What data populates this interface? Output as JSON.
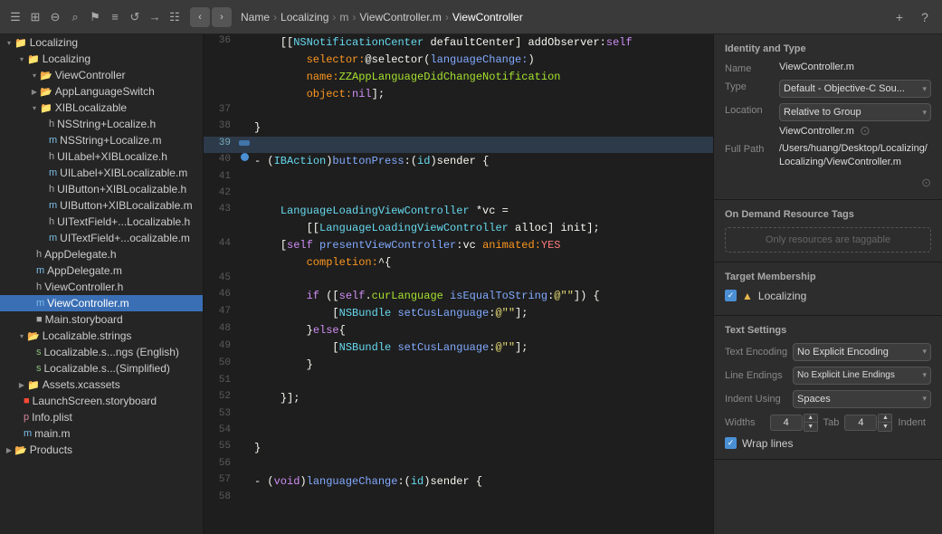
{
  "topbar": {
    "nav_back": "‹",
    "nav_forward": "›",
    "breadcrumbs": [
      "Localizing",
      "Localizing",
      "m",
      "ViewController.m",
      "ViewController"
    ],
    "action_plus": "+",
    "action_help": "?"
  },
  "sidebar": {
    "items": [
      {
        "id": "localizing-root",
        "label": "Localizing",
        "indent": 0,
        "type": "folder-yellow",
        "arrow": "▾",
        "selected": false
      },
      {
        "id": "localizing-sub",
        "label": "Localizing",
        "indent": 1,
        "type": "folder-yellow",
        "arrow": "▾",
        "selected": false
      },
      {
        "id": "viewcontroller",
        "label": "ViewController",
        "indent": 2,
        "type": "folder-blue",
        "arrow": "▾",
        "selected": false
      },
      {
        "id": "applanguageswitch",
        "label": "AppLanguageSwitch",
        "indent": 2,
        "type": "folder-blue",
        "arrow": "▶",
        "selected": false
      },
      {
        "id": "xiblocalizable",
        "label": "XIBLocalizable",
        "indent": 2,
        "type": "folder-yellow",
        "arrow": "▾",
        "selected": false
      },
      {
        "id": "nsstring-h",
        "label": "NSString+Localize.h",
        "indent": 3,
        "type": "file-h",
        "arrow": "",
        "selected": false
      },
      {
        "id": "nsstring-m",
        "label": "NSString+Localize.m",
        "indent": 3,
        "type": "file-m",
        "arrow": "",
        "selected": false
      },
      {
        "id": "uilabel-h",
        "label": "UILabel+XIBLocalize.h",
        "indent": 3,
        "type": "file-h",
        "arrow": "",
        "selected": false
      },
      {
        "id": "uilabel-m",
        "label": "UILabel+XIBLocalizable.m",
        "indent": 3,
        "type": "file-m",
        "arrow": "",
        "selected": false
      },
      {
        "id": "uibutton-h",
        "label": "UIButton+XIBLocalizable.h",
        "indent": 3,
        "type": "file-h",
        "arrow": "",
        "selected": false
      },
      {
        "id": "uibutton-m",
        "label": "UIButton+XIBLocalizable.m",
        "indent": 3,
        "type": "file-m",
        "arrow": "",
        "selected": false
      },
      {
        "id": "uitextfield-h",
        "label": "UITextField+...Localizable.h",
        "indent": 3,
        "type": "file-h",
        "arrow": "",
        "selected": false
      },
      {
        "id": "uitextfield-m",
        "label": "UITextField+...ocalizable.m",
        "indent": 3,
        "type": "file-m",
        "arrow": "",
        "selected": false
      },
      {
        "id": "appdelegate-h",
        "label": "AppDelegate.h",
        "indent": 2,
        "type": "file-h",
        "arrow": "",
        "selected": false
      },
      {
        "id": "appdelegate-m",
        "label": "AppDelegate.m",
        "indent": 2,
        "type": "file-m",
        "arrow": "",
        "selected": false
      },
      {
        "id": "viewcontroller-h",
        "label": "ViewController.h",
        "indent": 2,
        "type": "file-h",
        "arrow": "",
        "selected": false
      },
      {
        "id": "viewcontroller-m",
        "label": "ViewController.m",
        "indent": 2,
        "type": "file-m",
        "arrow": "",
        "selected": true
      },
      {
        "id": "main-storyboard",
        "label": "Main.storyboard",
        "indent": 2,
        "type": "file-storyboard",
        "arrow": "",
        "selected": false
      },
      {
        "id": "localizable-strings",
        "label": "Localizable.strings",
        "indent": 1,
        "type": "folder-blue",
        "arrow": "▾",
        "selected": false
      },
      {
        "id": "localizable-english",
        "label": "Localizable.s...ngs (English)",
        "indent": 2,
        "type": "file-strings",
        "arrow": "",
        "selected": false
      },
      {
        "id": "localizable-simplified",
        "label": "Localizable.s...(Simplified)",
        "indent": 2,
        "type": "file-strings",
        "arrow": "",
        "selected": false
      },
      {
        "id": "assets",
        "label": "Assets.xcassets",
        "indent": 1,
        "type": "folder-yellow",
        "arrow": "▶",
        "selected": false
      },
      {
        "id": "launchscreen",
        "label": "LaunchScreen.storyboard",
        "indent": 1,
        "type": "file-storyboard",
        "arrow": "",
        "selected": false
      },
      {
        "id": "info-plist",
        "label": "Info.plist",
        "indent": 1,
        "type": "file-plist",
        "arrow": "",
        "selected": false
      },
      {
        "id": "main-m",
        "label": "main.m",
        "indent": 1,
        "type": "file-m",
        "arrow": "",
        "selected": false
      },
      {
        "id": "products",
        "label": "Products",
        "indent": 0,
        "type": "folder-blue",
        "arrow": "▶",
        "selected": false
      }
    ]
  },
  "editor": {
    "lines": [
      {
        "num": "36",
        "indent": 0,
        "code": "    [[NSNotificationCenter defaultCenter] addObserver:self",
        "bp": false
      },
      {
        "num": "",
        "indent": 0,
        "code": "        selector:@selector(languageChange:)",
        "bp": false
      },
      {
        "num": "",
        "indent": 0,
        "code": "        name:ZZAppLanguageDidChangeNotification",
        "bp": false
      },
      {
        "num": "",
        "indent": 0,
        "code": "        object:nil];",
        "bp": false
      },
      {
        "num": "37",
        "indent": 0,
        "code": "",
        "bp": false
      },
      {
        "num": "38",
        "indent": 0,
        "code": "}",
        "bp": false
      },
      {
        "num": "39",
        "indent": 0,
        "code": "",
        "bp": false,
        "current": true
      },
      {
        "num": "40",
        "indent": 0,
        "code": "- (IBAction)buttonPress:(id)sender {",
        "bp": true
      },
      {
        "num": "41",
        "indent": 0,
        "code": "",
        "bp": false
      },
      {
        "num": "42",
        "indent": 0,
        "code": "",
        "bp": false
      },
      {
        "num": "43",
        "indent": 0,
        "code": "    LanguageLoadingViewController *vc =",
        "bp": false
      },
      {
        "num": "",
        "indent": 0,
        "code": "        [[LanguageLoadingViewController alloc] init];",
        "bp": false
      },
      {
        "num": "44",
        "indent": 0,
        "code": "    [self presentViewController:vc animated:YES",
        "bp": false
      },
      {
        "num": "",
        "indent": 0,
        "code": "        completion:^{",
        "bp": false
      },
      {
        "num": "45",
        "indent": 0,
        "code": "",
        "bp": false
      },
      {
        "num": "46",
        "indent": 0,
        "code": "        if ([self.curLanguage isEqualToString:@\"\"]) {",
        "bp": false
      },
      {
        "num": "47",
        "indent": 0,
        "code": "            [NSBundle setCusLanguage:@\"\"];",
        "bp": false
      },
      {
        "num": "48",
        "indent": 0,
        "code": "        }else{",
        "bp": false
      },
      {
        "num": "49",
        "indent": 0,
        "code": "            [NSBundle setCusLanguage:@\"\"];",
        "bp": false
      },
      {
        "num": "50",
        "indent": 0,
        "code": "        }",
        "bp": false
      },
      {
        "num": "51",
        "indent": 0,
        "code": "",
        "bp": false
      },
      {
        "num": "52",
        "indent": 0,
        "code": "    }];",
        "bp": false
      },
      {
        "num": "53",
        "indent": 0,
        "code": "",
        "bp": false
      },
      {
        "num": "54",
        "indent": 0,
        "code": "",
        "bp": false
      },
      {
        "num": "55",
        "indent": 0,
        "code": "}",
        "bp": false
      },
      {
        "num": "56",
        "indent": 0,
        "code": "",
        "bp": false
      },
      {
        "num": "57",
        "indent": 0,
        "code": "- (void)languageChange:(id)sender {",
        "bp": false
      },
      {
        "num": "58",
        "indent": 0,
        "code": "",
        "bp": false
      }
    ]
  },
  "right_panel": {
    "title_identity": "Identity and Type",
    "name_label": "Name",
    "name_value": "ViewController.m",
    "type_label": "Type",
    "type_value": "Default - Objective-C Sou...",
    "location_label": "Location",
    "location_value": "Relative to Group",
    "path_display": "ViewController.m",
    "fullpath_label": "Full Path",
    "fullpath_value": "/Users/huang/Desktop/Localizing/Localizing/ViewController.m",
    "title_tags": "On Demand Resource Tags",
    "tags_placeholder": "Only resources are taggable",
    "title_target": "Target Membership",
    "target_name": "Localizing",
    "title_text": "Text Settings",
    "encoding_label": "Text Encoding",
    "encoding_value": "No Explicit Encoding",
    "lineendings_label": "Line Endings",
    "lineendings_value": "No Explicit Line Endings",
    "indent_label": "Indent Using",
    "indent_value": "Spaces",
    "widths_label": "Widths",
    "tab_label": "Tab",
    "indent_num_label": "Indent",
    "tab_value": "4",
    "indent_value2": "4",
    "wrap_label": "Wrap lines"
  }
}
